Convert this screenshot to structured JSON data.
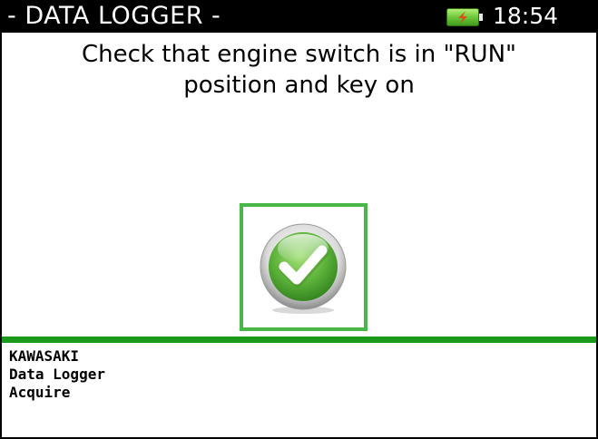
{
  "header": {
    "title": "- DATA LOGGER -",
    "time": "18:54",
    "battery_icon": "battery-charging-icon"
  },
  "message": {
    "line1": "Check that engine switch is in \"RUN\"",
    "line2": "position and key on"
  },
  "ok_button": {
    "icon": "checkmark-icon"
  },
  "footer": {
    "line1": "KAWASAKI",
    "line2": "Data Logger",
    "line3": "Acquire"
  },
  "colors": {
    "accent_green": "#1a9a1a",
    "button_border": "#49b649",
    "title_bg": "#000000"
  }
}
